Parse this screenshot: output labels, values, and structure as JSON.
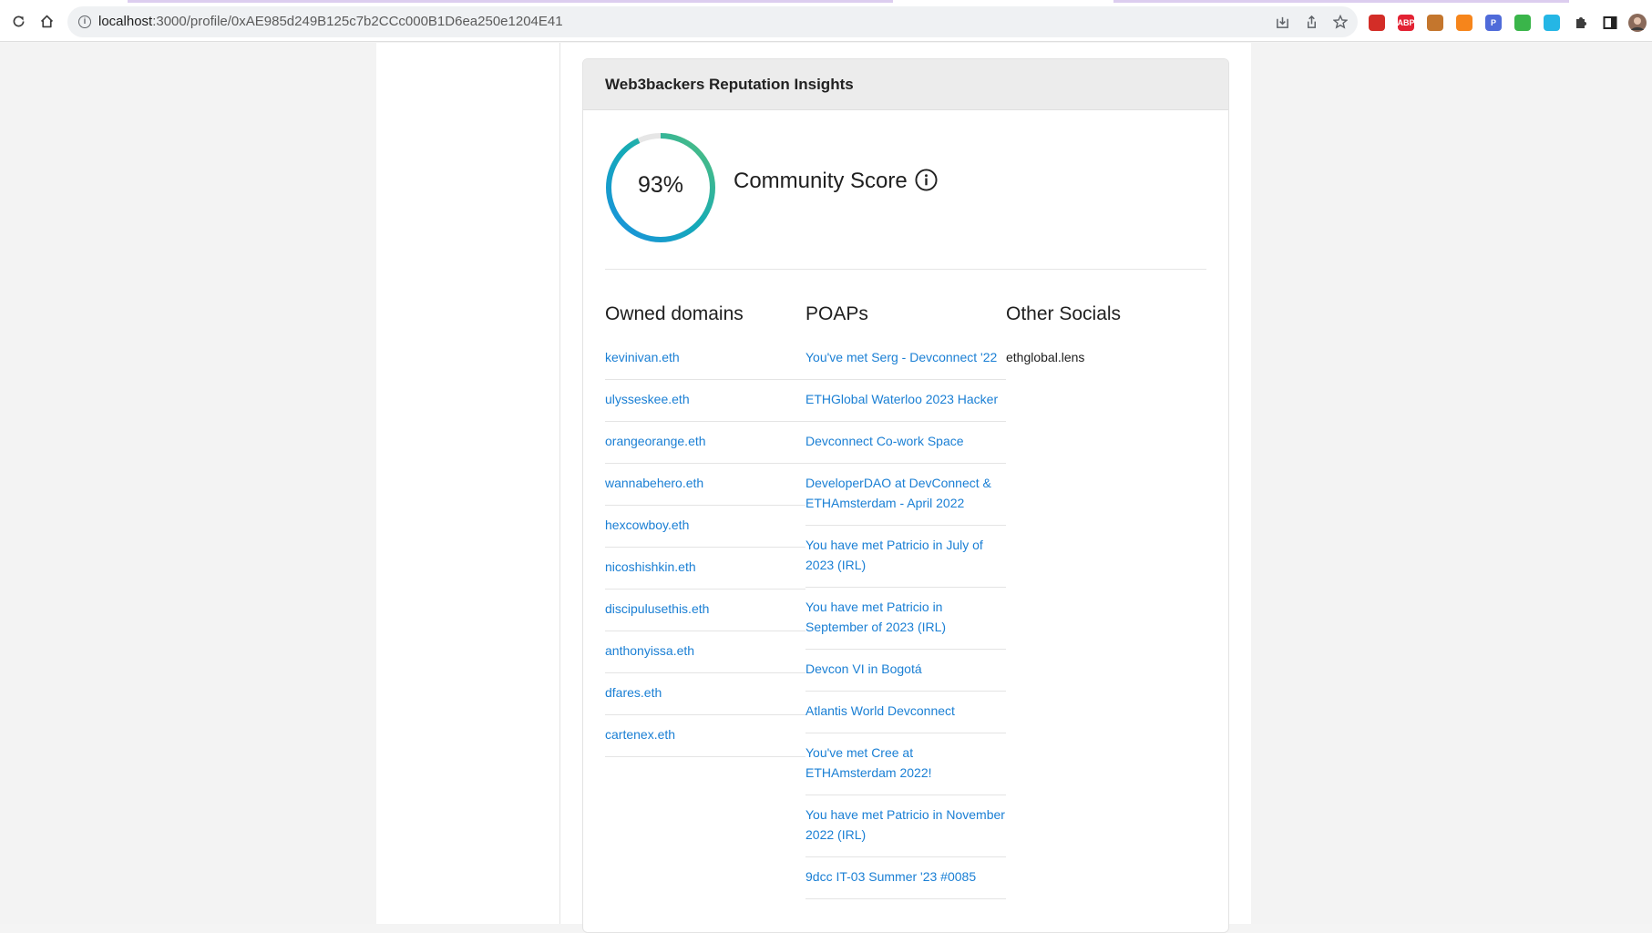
{
  "browser": {
    "url_host": "localhost",
    "url_path": ":3000/profile/0xAE985d249B125c7b2CCc000B1D6ea250e1204E41",
    "extensions": [
      {
        "name": "lastpass-icon",
        "label": "",
        "color": "#d32d27"
      },
      {
        "name": "adblock-icon",
        "label": "ABP",
        "color": "#e32233"
      },
      {
        "name": "extension-icon",
        "label": "",
        "color": "#c4762d"
      },
      {
        "name": "metamask-icon",
        "label": "",
        "color": "#f6851b"
      },
      {
        "name": "p-icon",
        "label": "P",
        "color": "#4f6bd9"
      },
      {
        "name": "colorwheel-icon",
        "label": "",
        "color": "#3ab54a"
      },
      {
        "name": "stack-icon",
        "label": "",
        "color": "#25b6e5"
      }
    ]
  },
  "card": {
    "title": "Web3backers Reputation Insights",
    "score": {
      "value": 93,
      "display": "93%",
      "label": "Community Score"
    }
  },
  "owned_domains": {
    "title": "Owned domains",
    "items": [
      "kevinivan.eth",
      "ulysseskee.eth",
      "orangeorange.eth",
      "wannabehero.eth",
      "hexcowboy.eth",
      "nicoshishkin.eth",
      "discipulusethis.eth",
      "anthonyissa.eth",
      "dfares.eth",
      "cartenex.eth"
    ]
  },
  "poaps": {
    "title": "POAPs",
    "items": [
      "You've met Serg - Devconnect '22",
      "ETHGlobal Waterloo 2023 Hacker",
      "Devconnect Co-work Space",
      "DeveloperDAO at DevConnect & ETHAmsterdam - April 2022",
      "You have met Patricio in July of 2023 (IRL)",
      "You have met Patricio in September of 2023 (IRL)",
      "Devcon VI in Bogotá",
      "Atlantis World Devconnect",
      "You've met Cree at ETHAmsterdam 2022!",
      "You have met Patricio in November 2022 (IRL)",
      "9dcc IT-03 Summer '23 #0085"
    ]
  },
  "other_socials": {
    "title": "Other Socials",
    "items": [
      "ethglobal.lens"
    ]
  }
}
